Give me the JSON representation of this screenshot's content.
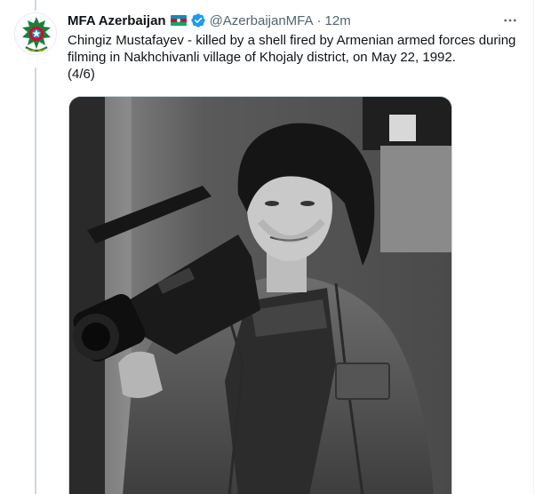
{
  "tweet": {
    "author": {
      "name": "MFA Azerbaijan",
      "flag_icon": "azerbaijan-flag-icon",
      "verified_icon": "verified-badge-icon",
      "handle": "@AzerbaijanMFA",
      "separator": "·",
      "time": "12m",
      "avatar_icon": "azerbaijan-state-emblem-icon"
    },
    "text_lines": [
      "Chingiz Mustafayev - killed by a shell fired by Armenian armed forces during",
      "filming in Nakhchivanli village of Khojaly district, on May 22, 1992.",
      "(4/6)"
    ],
    "media": {
      "type": "black-and-white photograph",
      "alt": ""
    },
    "more_icon": "more-options-icon"
  },
  "colors": {
    "text_primary": "#0f1419",
    "text_secondary": "#536471",
    "verified_blue": "#1d9bf0",
    "thread_line": "#cfd9de"
  }
}
